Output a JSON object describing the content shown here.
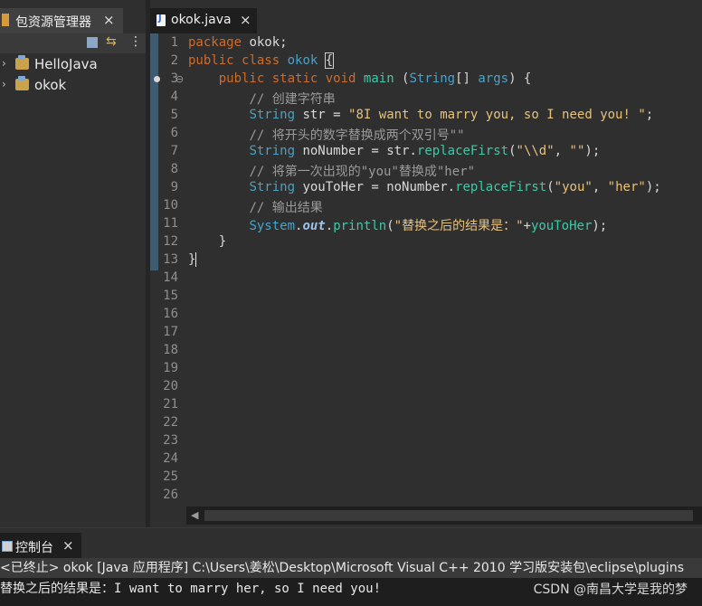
{
  "explorer": {
    "tab_label": "包资源管理器",
    "close_glyph": "×",
    "menu_glyph": "⋮",
    "projects": [
      {
        "label": "HelloJava",
        "expander": "›"
      },
      {
        "label": "okok",
        "expander": "›"
      }
    ]
  },
  "editor": {
    "tab_label": "okok.java",
    "close_glyph": "×",
    "line_numbers": [
      "1",
      "2",
      "3",
      "4",
      "5",
      "6",
      "7",
      "8",
      "9",
      "10",
      "11",
      "12",
      "13",
      "14",
      "15",
      "16",
      "17",
      "18",
      "19",
      "20",
      "21",
      "22",
      "23",
      "24",
      "25",
      "26"
    ],
    "fold_marker": "⊖",
    "code": {
      "l1_kw": "package",
      "l1_rest": " okok;",
      "l2_kw1": "public",
      "l2_kw2": "class",
      "l2_name": "okok",
      "l2_brace": "{",
      "l3_kw1": "public",
      "l3_kw2": "static",
      "l3_kw3": "void",
      "l3_name": "main",
      "l3_open": " (",
      "l3_type": "String",
      "l3_arr": "[] ",
      "l3_arg": "args",
      "l3_close": ") {",
      "l4_comment": "// 创建字符串",
      "l5_type": "String",
      "l5_var": "str",
      "l5_eq": " = ",
      "l5_str": "\"8I want to marry you, so I need you! \"",
      "l5_end": ";",
      "l6_comment": "// 将开头的数字替换成两个双引号\"\"",
      "l7_type": "String",
      "l7_var": "noNumber",
      "l7_eq": " = ",
      "l7_obj": "str",
      "l7_dot": ".",
      "l7_fn": "replaceFirst",
      "l7_open": "(",
      "l7_s1": "\"\\\\d\"",
      "l7_comma": ", ",
      "l7_s2": "\"\"",
      "l7_end": ");",
      "l8_comment": "// 将第一次出现的\"you\"替换成\"her\"",
      "l9_type": "String",
      "l9_var": "youToHer",
      "l9_eq": " = ",
      "l9_obj": "noNumber",
      "l9_dot": ".",
      "l9_fn": "replaceFirst",
      "l9_open": "(",
      "l9_s1": "\"you\"",
      "l9_comma": ", ",
      "l9_s2": "\"her\"",
      "l9_end": ");",
      "l10_comment": "// 输出结果",
      "l11_sys": "System",
      "l11_dot1": ".",
      "l11_out": "out",
      "l11_dot2": ".",
      "l11_fn": "println",
      "l11_open": "(",
      "l11_str": "\"替换之后的结果是：\"",
      "l11_plus": "+",
      "l11_var": "youToHer",
      "l11_end": ");",
      "l12": "}",
      "l13": "}"
    },
    "scroll_left_glyph": "◀"
  },
  "console": {
    "tab_label": "控制台",
    "close_glyph": "×",
    "status": "<已终止> okok [Java 应用程序] C:\\Users\\姜松\\Desktop\\Microsoft Visual C++ 2010 学习版安装包\\eclipse\\plugins",
    "output": "替换之后的结果是：I want to marry her, so I need you!",
    "watermark": "CSDN @南昌大学是我的梦"
  }
}
